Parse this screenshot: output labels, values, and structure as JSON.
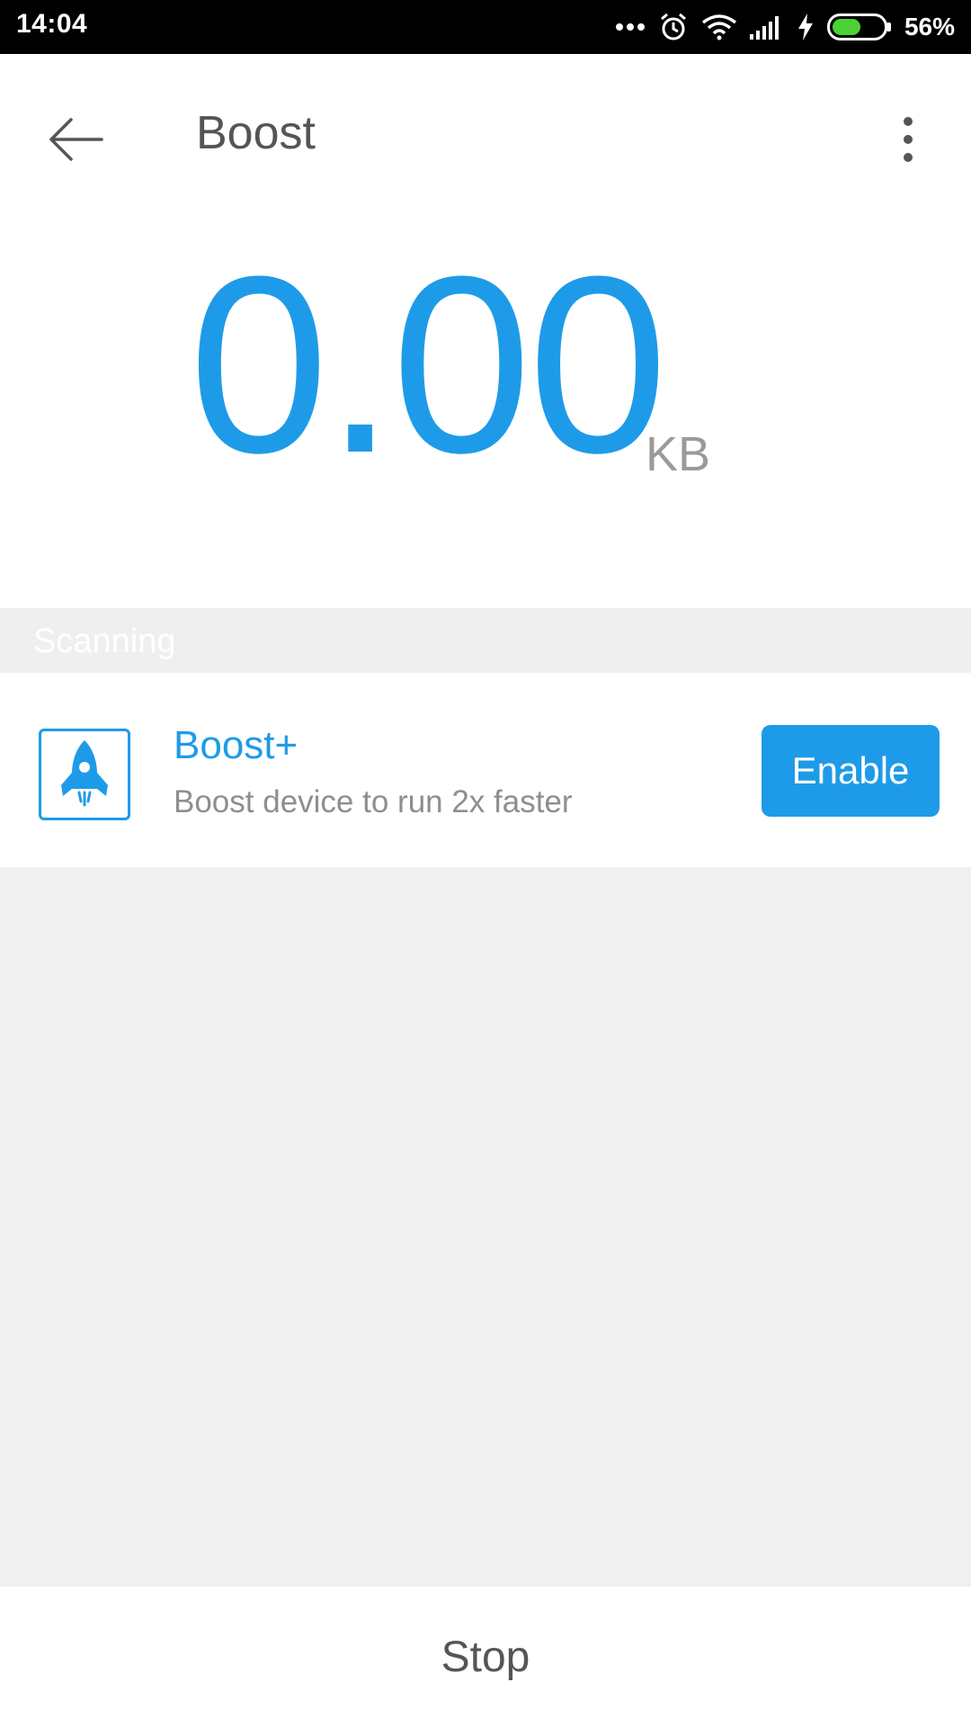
{
  "status_bar": {
    "time": "14:04",
    "battery_percent": "56%",
    "battery_level": 0.56,
    "icons": [
      "more-dots-icon",
      "alarm-icon",
      "wifi-icon",
      "signal-icon",
      "charging-icon",
      "battery-icon"
    ]
  },
  "app_bar": {
    "title": "Boost",
    "back_icon": "arrow-back-icon",
    "menu_icon": "more-vert-icon"
  },
  "readout": {
    "value": "0.00",
    "unit": "KB"
  },
  "scanning": {
    "label": "Scanning"
  },
  "boost_card": {
    "icon": "rocket-icon",
    "title": "Boost+",
    "subtitle": "Boost device to run 2x faster",
    "button_label": "Enable"
  },
  "bottom_bar": {
    "stop_label": "Stop"
  },
  "colors": {
    "accent": "#1e9be8",
    "battery_fill": "#4cd137"
  }
}
